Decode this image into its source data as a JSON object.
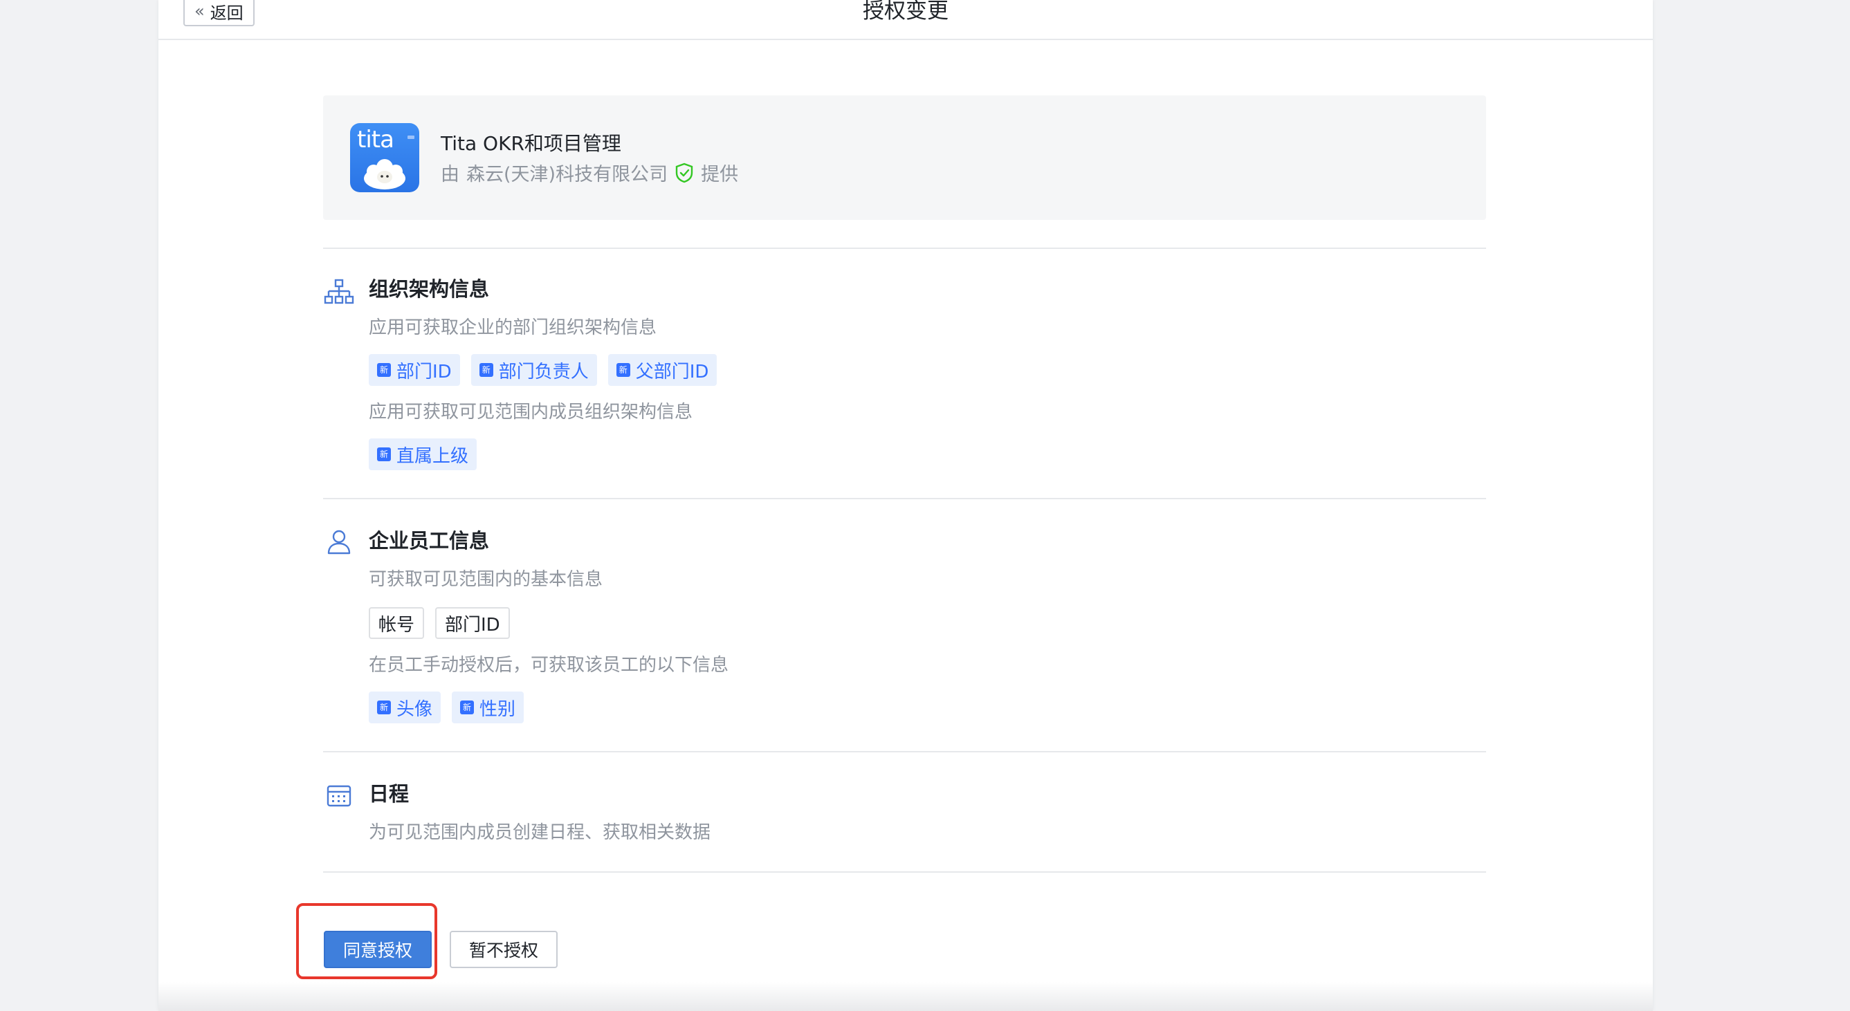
{
  "header": {
    "back_label": "返回",
    "title": "授权变更"
  },
  "app": {
    "logo_text": "tita",
    "name": "Tita OKR和项目管理",
    "provider_prefix": "由",
    "provider_name": "森云(天津)科技有限公司",
    "provider_suffix": "提供"
  },
  "sections": [
    {
      "title": "组织架构信息",
      "icon": "org-chart-icon",
      "groups": [
        {
          "desc": "应用可获取企业的部门组织架构信息",
          "tags": [
            "部门ID",
            "部门负责人",
            "父部门ID"
          ],
          "new": true
        },
        {
          "desc": "应用可获取可见范围内成员组织架构信息",
          "tags": [
            "直属上级"
          ],
          "new": true
        }
      ]
    },
    {
      "title": "企业员工信息",
      "icon": "user-icon",
      "groups": [
        {
          "desc": "可获取可见范围内的基本信息",
          "tags": [
            "帐号",
            "部门ID"
          ],
          "new": false
        },
        {
          "desc": "在员工手动授权后，可获取该员工的以下信息",
          "tags": [
            "头像",
            "性别"
          ],
          "new": true
        }
      ]
    },
    {
      "title": "日程",
      "icon": "calendar-icon",
      "groups": [
        {
          "desc": "为可见范围内成员创建日程、获取相关数据",
          "tags": [],
          "new": false
        }
      ]
    }
  ],
  "new_badge": "新",
  "actions": {
    "agree_label": "同意授权",
    "decline_label": "暂不授权"
  },
  "colors": {
    "accent": "#3370ff",
    "primary_button": "#3f7fdc",
    "highlight": "#e8372c",
    "verified": "#34c724"
  }
}
